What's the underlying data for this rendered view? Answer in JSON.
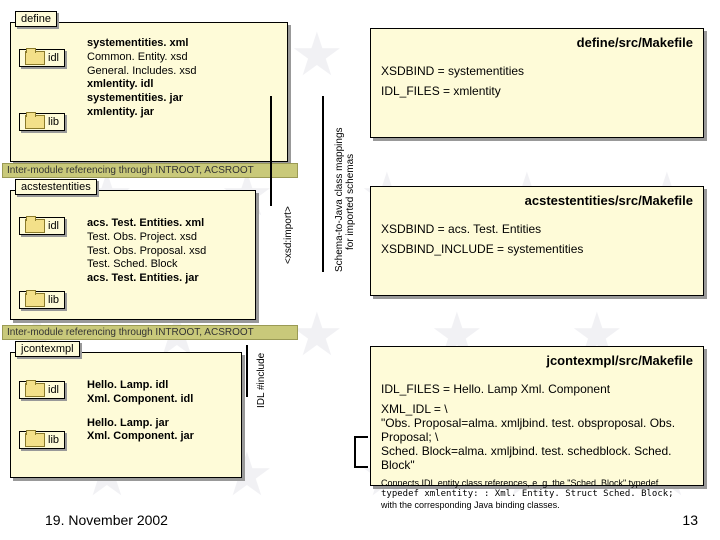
{
  "sections": {
    "define": {
      "label": "define",
      "idl": "idl",
      "lib": "lib",
      "files": {
        "h1": "systementities. xml",
        "l1": "Common. Entity. xsd",
        "l2": "General. Includes. xsd",
        "h2": "xmlentity. idl",
        "h3": "systementities. jar",
        "h4": "xmlentity. jar"
      }
    },
    "acs": {
      "label": "acstestentities",
      "idl": "idl",
      "lib": "lib",
      "files": {
        "h1": "acs. Test. Entities. xml",
        "l1": "Test. Obs. Project. xsd",
        "l2": "Test. Obs. Proposal. xsd",
        "l3": "Test. Sched. Block",
        "h2": "acs. Test. Entities. jar"
      }
    },
    "jcon": {
      "label": "jcontexmpl",
      "idl": "idl",
      "lib": "lib",
      "files": {
        "h1": "Hello. Lamp. idl",
        "h2": "Xml. Component. idl",
        "h3": "Hello. Lamp. jar",
        "h4": "Xml. Component. jar"
      }
    }
  },
  "refbar": "Inter-module referencing through INTROOT, ACSROOT",
  "makes": {
    "define": {
      "title": "define/src/Makefile",
      "l1": "XSDBIND = systementities",
      "l2": "IDL_FILES = xmlentity"
    },
    "acs": {
      "title": "acstestentities/src/Makefile",
      "l1": "XSDBIND = acs. Test. Entities",
      "l2": "XSDBIND_INCLUDE = systementities"
    },
    "jcon": {
      "title": "jcontexmpl/src/Makefile",
      "l1": "IDL_FILES = Hello. Lamp Xml. Component",
      "l2": "XML_IDL = \\",
      "l3": " \"Obs. Proposal=alma. xmljbind. test. obsproposal. Obs. Proposal; \\",
      "l4": "  Sched. Block=alma. xmljbind. test. schedblock. Sched. Block\"",
      "note1": "Connects IDL entity class references, e. g. the \"Sched. Block\" typedef",
      "note2": "typedef xmlentity: : Xml. Entity. Struct Sched. Block;",
      "note3": "with the corresponding Java binding classes."
    }
  },
  "vlabels": {
    "import": "<xsd:import>",
    "schema1": "Schema-to-Java class mappings",
    "schema2": "for imported schemas",
    "include": "IDL #include"
  },
  "footer": {
    "date": "19. November 2002",
    "page": "13"
  }
}
